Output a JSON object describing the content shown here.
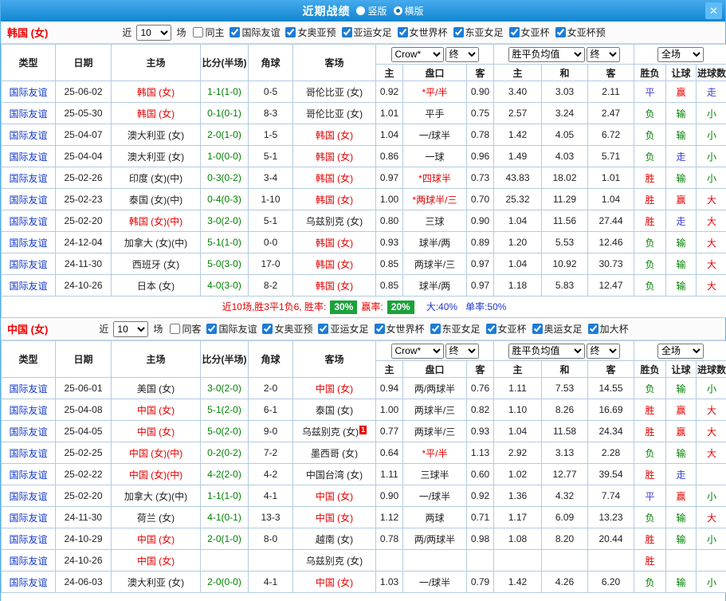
{
  "colors": {
    "titlebar_blue": "#2492dc",
    "link_blue": "#1237cc",
    "team_red": "#e60000",
    "score_green": "#008000",
    "win_red": "#e60000",
    "draw_walk_blue": "#3f3fd6",
    "lose_green": "#008000",
    "badge_green": "#1ba23a",
    "table_border_blue": "#b4cbe2"
  },
  "titlebar": {
    "title": "近期战绩",
    "layout_options": [
      {
        "label": "竖版",
        "selected": false
      },
      {
        "label": "横版",
        "selected": true
      }
    ],
    "close_glyph": "✕"
  },
  "table_header": {
    "main_cols": [
      "类型",
      "日期",
      "主场",
      "比分(半场)",
      "角球",
      "客场"
    ],
    "sub_cols": [
      "主",
      "盘口",
      "客",
      "主",
      "和",
      "客",
      "胜负",
      "让球",
      "进球数"
    ],
    "selects": {
      "odds_source": "Crow*",
      "odds_stage_1": "终",
      "avg_source": "胜平负均值",
      "odds_stage_2": "终",
      "scope": "全场"
    }
  },
  "sections": [
    {
      "team_title": "韩国 (女)",
      "filter": {
        "near_label": "近",
        "count": "10",
        "games_label": "场",
        "same_venue": {
          "label": "同主",
          "checked": false
        },
        "competitions": [
          {
            "label": "国际友谊",
            "checked": true
          },
          {
            "label": "女奥亚预",
            "checked": true
          },
          {
            "label": "亚运女足",
            "checked": true
          },
          {
            "label": "女世界杯",
            "checked": true
          },
          {
            "label": "东亚女足",
            "checked": true
          },
          {
            "label": "女亚杯",
            "checked": true
          },
          {
            "label": "女亚杯预",
            "checked": true
          }
        ]
      },
      "rows": [
        {
          "type": "国际友谊",
          "date": "25-06-02",
          "home": "韩国 (女)",
          "home_red": true,
          "score": "1-1(1-0)",
          "corner": "0-5",
          "away": "哥伦比亚 (女)",
          "away_red": false,
          "odds_home": "0.92",
          "handicap": "*平/半",
          "odds_away": "0.90",
          "avg_home": "3.40",
          "avg_draw": "3.03",
          "avg_away": "2.11",
          "result": "平",
          "handicap_result": "赢",
          "goals": "走"
        },
        {
          "type": "国际友谊",
          "date": "25-05-30",
          "home": "韩国 (女)",
          "home_red": true,
          "score": "0-1(0-1)",
          "corner": "8-3",
          "away": "哥伦比亚 (女)",
          "away_red": false,
          "odds_home": "1.01",
          "handicap": "平手",
          "odds_away": "0.75",
          "avg_home": "2.57",
          "avg_draw": "3.24",
          "avg_away": "2.47",
          "result": "负",
          "handicap_result": "输",
          "goals": "小"
        },
        {
          "type": "国际友谊",
          "date": "25-04-07",
          "home": "澳大利亚 (女)",
          "home_red": false,
          "score": "2-0(1-0)",
          "corner": "1-5",
          "away": "韩国 (女)",
          "away_red": true,
          "odds_home": "1.04",
          "handicap": "一/球半",
          "odds_away": "0.78",
          "avg_home": "1.42",
          "avg_draw": "4.05",
          "avg_away": "6.72",
          "result": "负",
          "handicap_result": "输",
          "goals": "小"
        },
        {
          "type": "国际友谊",
          "date": "25-04-04",
          "home": "澳大利亚 (女)",
          "home_red": false,
          "score": "1-0(0-0)",
          "corner": "5-1",
          "away": "韩国 (女)",
          "away_red": true,
          "odds_home": "0.86",
          "handicap": "一球",
          "odds_away": "0.96",
          "avg_home": "1.49",
          "avg_draw": "4.03",
          "avg_away": "5.71",
          "result": "负",
          "handicap_result": "走",
          "goals": "小"
        },
        {
          "type": "国际友谊",
          "date": "25-02-26",
          "home": "印度 (女)(中)",
          "home_red": false,
          "score": "0-3(0-2)",
          "corner": "3-4",
          "away": "韩国 (女)",
          "away_red": true,
          "odds_home": "0.97",
          "handicap": "*四球半",
          "odds_away": "0.73",
          "avg_home": "43.83",
          "avg_draw": "18.02",
          "avg_away": "1.01",
          "result": "胜",
          "handicap_result": "输",
          "goals": "小"
        },
        {
          "type": "国际友谊",
          "date": "25-02-23",
          "home": "泰国 (女)(中)",
          "home_red": false,
          "score": "0-4(0-3)",
          "corner": "1-10",
          "away": "韩国 (女)",
          "away_red": true,
          "odds_home": "1.00",
          "handicap": "*两球半/三",
          "odds_away": "0.70",
          "avg_home": "25.32",
          "avg_draw": "11.29",
          "avg_away": "1.04",
          "result": "胜",
          "handicap_result": "赢",
          "goals": "大"
        },
        {
          "type": "国际友谊",
          "date": "25-02-20",
          "home": "韩国 (女)(中)",
          "home_red": true,
          "score": "3-0(2-0)",
          "corner": "5-1",
          "away": "乌兹别克 (女)",
          "away_red": false,
          "odds_home": "0.80",
          "handicap": "三球",
          "odds_away": "0.90",
          "avg_home": "1.04",
          "avg_draw": "11.56",
          "avg_away": "27.44",
          "result": "胜",
          "handicap_result": "走",
          "goals": "大"
        },
        {
          "type": "国际友谊",
          "date": "24-12-04",
          "home": "加拿大 (女)(中)",
          "home_red": false,
          "score": "5-1(1-0)",
          "corner": "0-0",
          "away": "韩国 (女)",
          "away_red": true,
          "odds_home": "0.93",
          "handicap": "球半/两",
          "odds_away": "0.89",
          "avg_home": "1.20",
          "avg_draw": "5.53",
          "avg_away": "12.46",
          "result": "负",
          "handicap_result": "输",
          "goals": "大"
        },
        {
          "type": "国际友谊",
          "date": "24-11-30",
          "home": "西班牙 (女)",
          "home_red": false,
          "score": "5-0(3-0)",
          "corner": "17-0",
          "away": "韩国 (女)",
          "away_red": true,
          "odds_home": "0.85",
          "handicap": "两球半/三",
          "odds_away": "0.97",
          "avg_home": "1.04",
          "avg_draw": "10.92",
          "avg_away": "30.73",
          "result": "负",
          "handicap_result": "输",
          "goals": "大"
        },
        {
          "type": "国际友谊",
          "date": "24-10-26",
          "home": "日本 (女)",
          "home_red": false,
          "score": "4-0(3-0)",
          "corner": "8-2",
          "away": "韩国 (女)",
          "away_red": true,
          "odds_home": "0.85",
          "handicap": "球半/两",
          "odds_away": "0.97",
          "avg_home": "1.18",
          "avg_draw": "5.83",
          "avg_away": "12.47",
          "result": "负",
          "handicap_result": "输",
          "goals": "大"
        }
      ],
      "summary": {
        "record_text": "近10场,胜3平1负6, 胜率:",
        "win_rate": "30%",
        "handicap_label": "赢率:",
        "handicap_rate": "20%",
        "big_text": "大:40%",
        "single_text": "单率:50%"
      }
    },
    {
      "team_title": "中国 (女)",
      "filter": {
        "near_label": "近",
        "count": "10",
        "games_label": "场",
        "same_venue": {
          "label": "同客",
          "checked": false
        },
        "competitions": [
          {
            "label": "国际友谊",
            "checked": true
          },
          {
            "label": "女奥亚预",
            "checked": true
          },
          {
            "label": "亚运女足",
            "checked": true
          },
          {
            "label": "女世界杯",
            "checked": true
          },
          {
            "label": "东亚女足",
            "checked": true
          },
          {
            "label": "女亚杯",
            "checked": true
          },
          {
            "label": "奥运女足",
            "checked": true
          },
          {
            "label": "加大杯",
            "checked": true
          }
        ]
      },
      "rows": [
        {
          "type": "国际友谊",
          "date": "25-06-01",
          "home": "美国 (女)",
          "home_red": false,
          "score": "3-0(2-0)",
          "corner": "2-0",
          "away": "中国 (女)",
          "away_red": true,
          "odds_home": "0.94",
          "handicap": "两/两球半",
          "odds_away": "0.76",
          "avg_home": "1.11",
          "avg_draw": "7.53",
          "avg_away": "14.55",
          "result": "负",
          "handicap_result": "输",
          "goals": "小"
        },
        {
          "type": "国际友谊",
          "date": "25-04-08",
          "home": "中国 (女)",
          "home_red": true,
          "score": "5-1(2-0)",
          "corner": "6-1",
          "away": "泰国 (女)",
          "away_red": false,
          "odds_home": "1.00",
          "handicap": "两球半/三",
          "odds_away": "0.82",
          "avg_home": "1.10",
          "avg_draw": "8.26",
          "avg_away": "16.69",
          "result": "胜",
          "handicap_result": "赢",
          "goals": "大"
        },
        {
          "type": "国际友谊",
          "date": "25-04-05",
          "home": "中国 (女)",
          "home_red": true,
          "score": "5-0(2-0)",
          "corner": "9-0",
          "away": "乌兹别克 (女)",
          "away_red": false,
          "away_badge": "1",
          "odds_home": "0.77",
          "handicap": "两球半/三",
          "odds_away": "0.93",
          "avg_home": "1.04",
          "avg_draw": "11.58",
          "avg_away": "24.34",
          "result": "胜",
          "handicap_result": "赢",
          "goals": "大"
        },
        {
          "type": "国际友谊",
          "date": "25-02-25",
          "home": "中国 (女)(中)",
          "home_red": true,
          "score": "0-2(0-2)",
          "corner": "7-2",
          "away": "墨西哥 (女)",
          "away_red": false,
          "odds_home": "0.64",
          "handicap": "*平/半",
          "odds_away": "1.13",
          "avg_home": "2.92",
          "avg_draw": "3.13",
          "avg_away": "2.28",
          "result": "负",
          "handicap_result": "输",
          "goals": "大"
        },
        {
          "type": "国际友谊",
          "date": "25-02-22",
          "home": "中国 (女)(中)",
          "home_red": true,
          "score": "4-2(2-0)",
          "corner": "4-2",
          "away": "中国台湾 (女)",
          "away_red": false,
          "odds_home": "1.11",
          "handicap": "三球半",
          "odds_away": "0.60",
          "avg_home": "1.02",
          "avg_draw": "12.77",
          "avg_away": "39.54",
          "result": "胜",
          "handicap_result": "走",
          "goals": ""
        },
        {
          "type": "国际友谊",
          "date": "25-02-20",
          "home": "加拿大 (女)(中)",
          "home_red": false,
          "score": "1-1(1-0)",
          "corner": "4-1",
          "away": "中国 (女)",
          "away_red": true,
          "odds_home": "0.90",
          "handicap": "一/球半",
          "odds_away": "0.92",
          "avg_home": "1.36",
          "avg_draw": "4.32",
          "avg_away": "7.74",
          "result": "平",
          "handicap_result": "赢",
          "goals": "小"
        },
        {
          "type": "国际友谊",
          "date": "24-11-30",
          "home": "荷兰 (女)",
          "home_red": false,
          "score": "4-1(0-1)",
          "corner": "13-3",
          "away": "中国 (女)",
          "away_red": true,
          "odds_home": "1.12",
          "handicap": "两球",
          "odds_away": "0.71",
          "avg_home": "1.17",
          "avg_draw": "6.09",
          "avg_away": "13.23",
          "result": "负",
          "handicap_result": "输",
          "goals": "大"
        },
        {
          "type": "国际友谊",
          "date": "24-10-29",
          "home": "中国 (女)",
          "home_red": true,
          "score": "2-0(1-0)",
          "corner": "8-0",
          "away": "越南 (女)",
          "away_red": false,
          "odds_home": "0.78",
          "handicap": "两/两球半",
          "odds_away": "0.98",
          "avg_home": "1.08",
          "avg_draw": "8.20",
          "avg_away": "20.44",
          "result": "胜",
          "handicap_result": "输",
          "goals": "小"
        },
        {
          "type": "国际友谊",
          "date": "24-10-26",
          "home": "中国 (女)",
          "home_red": true,
          "score": "",
          "corner": "",
          "away": "乌兹别克 (女)",
          "away_red": false,
          "odds_home": "",
          "handicap": "",
          "odds_away": "",
          "avg_home": "",
          "avg_draw": "",
          "avg_away": "",
          "result": "胜",
          "handicap_result": "",
          "goals": ""
        },
        {
          "type": "国际友谊",
          "date": "24-06-03",
          "home": "澳大利亚 (女)",
          "home_red": false,
          "score": "2-0(0-0)",
          "corner": "4-1",
          "away": "中国 (女)",
          "away_red": true,
          "odds_home": "1.03",
          "handicap": "一/球半",
          "odds_away": "0.79",
          "avg_home": "1.42",
          "avg_draw": "4.26",
          "avg_away": "6.20",
          "result": "负",
          "handicap_result": "输",
          "goals": "小"
        }
      ],
      "summary": null
    }
  ]
}
